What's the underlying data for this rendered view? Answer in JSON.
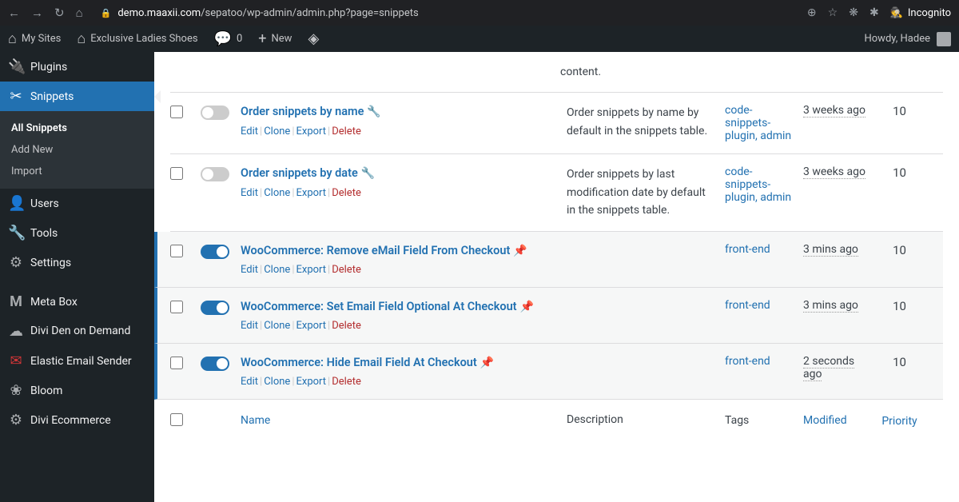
{
  "browser": {
    "url_domain": "demo.maaxii.com",
    "url_path": "/sepatoo/wp-admin/admin.php?page=snippets",
    "incognito": "Incognito"
  },
  "toolbar": {
    "my_sites": "My Sites",
    "site_name": "Exclusive Ladies Shoes",
    "comments": "0",
    "new": "New",
    "greeting": "Howdy, Hadee"
  },
  "sidebar": {
    "plugins": "Plugins",
    "snippets": "Snippets",
    "submenu": {
      "all": "All Snippets",
      "add": "Add New",
      "import": "Import"
    },
    "users": "Users",
    "tools": "Tools",
    "settings": "Settings",
    "meta_box": "Meta Box",
    "divi_den": "Divi Den on Demand",
    "elastic": "Elastic Email Sender",
    "bloom": "Bloom",
    "divi_ecom": "Divi Ecommerce"
  },
  "actions": {
    "edit": "Edit",
    "clone": "Clone",
    "export": "Export",
    "delete": "Delete"
  },
  "columns": {
    "name": "Name",
    "description": "Description",
    "tags": "Tags",
    "modified": "Modified",
    "priority": "Priority"
  },
  "rows": [
    {
      "title": "Order snippets by name",
      "active": false,
      "highlighted": false,
      "pin": true,
      "pin_style": "wrench",
      "desc": "Order snippets by name by default in the snippets table.",
      "tags": "code-snippets-plugin, admin",
      "modified": "3 weeks ago",
      "priority": "10"
    },
    {
      "title": "Order snippets by date",
      "active": false,
      "highlighted": false,
      "pin": true,
      "pin_style": "wrench",
      "desc": "Order snippets by last modification date by default in the snippets table.",
      "tags": "code-snippets-plugin, admin",
      "modified": "3 weeks ago",
      "priority": "10"
    },
    {
      "title": "WooCommerce: Remove eMail Field From Checkout",
      "active": true,
      "highlighted": true,
      "pin": true,
      "pin_style": "pin",
      "desc": "",
      "tags": "front-end",
      "modified": "3 mins ago",
      "priority": "10"
    },
    {
      "title": "WooCommerce: Set Email Field Optional At Checkout",
      "active": true,
      "highlighted": true,
      "pin": true,
      "pin_style": "pin",
      "desc": "",
      "tags": "front-end",
      "modified": "3 mins ago",
      "priority": "10"
    },
    {
      "title": "WooCommerce: Hide Email Field At Checkout",
      "active": true,
      "highlighted": true,
      "pin": true,
      "pin_style": "pin",
      "desc": "",
      "tags": "front-end",
      "modified": "2 seconds ago",
      "priority": "10"
    }
  ],
  "top_fragment": "content."
}
